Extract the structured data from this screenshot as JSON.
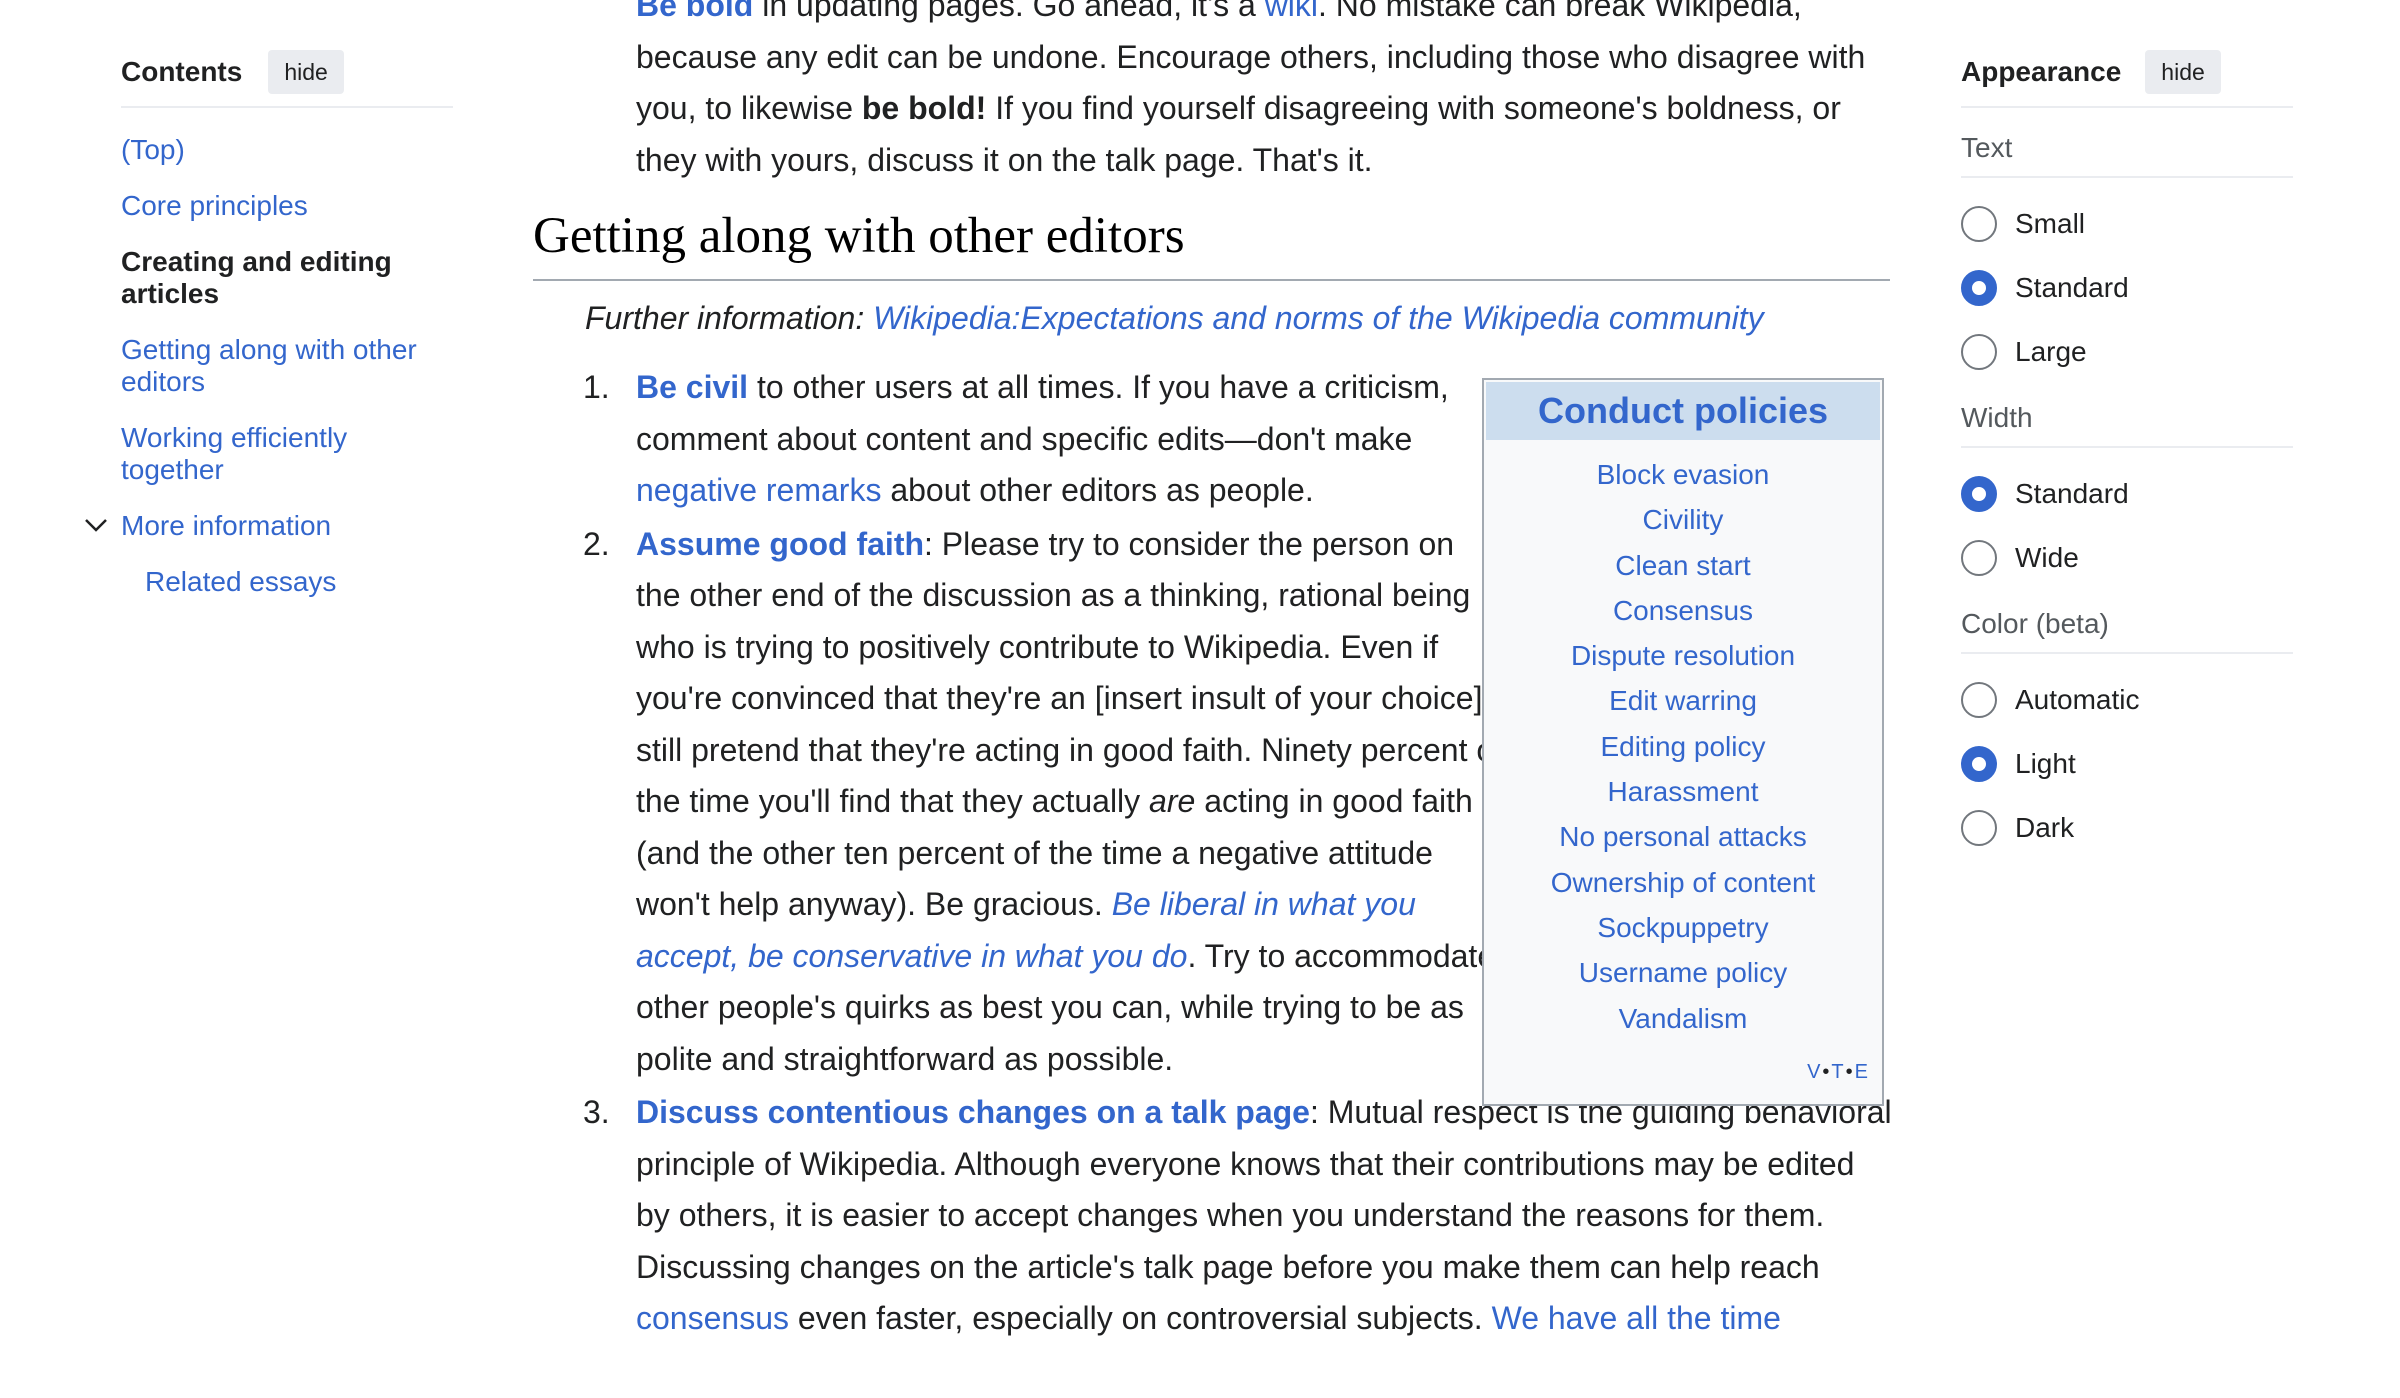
{
  "toc": {
    "title": "Contents",
    "hide_label": "hide",
    "items": [
      {
        "label": "(Top)"
      },
      {
        "label": "Core principles"
      },
      {
        "label": "Creating and editing articles"
      },
      {
        "label": "Getting along with other editors"
      },
      {
        "label": "Working efficiently together"
      },
      {
        "label": "More information"
      },
      {
        "label": "Related essays"
      }
    ]
  },
  "top_para": {
    "line0_a": "Be bold",
    "line0_b": " in updating pages. Go ahead, it's a ",
    "line0_wiki": "wiki",
    "line0_c": ". No mistake can break Wikipedia, because any edit can be undone. Encourage others, including those who disagree with you, to likewise ",
    "be_bold": "be bold!",
    "rest": " If you find yourself disagreeing with someone's boldness, or they with yours, discuss it on the talk page. That's it."
  },
  "section": {
    "heading": "Getting along with other editors",
    "hatnote_prefix": "Further information: ",
    "hatnote_link": "Wikipedia:Expectations and norms of the Wikipedia community"
  },
  "items": {
    "one": {
      "num": "1.",
      "link": "Be civil",
      "text_a": " to other users at all times. If you have a criticism, comment about content and specific edits—don't make ",
      "link2": "negative remarks",
      "text_b": " about other editors as people."
    },
    "two": {
      "num": "2.",
      "link": "Assume good faith",
      "text_a": ": Please try to consider the person on the other end of the discussion as a thinking, rational being who is trying to positively contribute to Wikipedia. Even if you're convinced that they're an [insert insult of your choice], still pretend that they're acting in good faith. Ninety percent of the time you'll find that they actually ",
      "are": "are",
      "text_b": " acting in good faith (and the other ten percent of the time a negative attitude won't help anyway). Be gracious. ",
      "link2": "Be liberal in what you accept, be conservative in what you do",
      "text_c": ". Try to accommodate other people's quirks as best you can, while trying to be as polite and straightforward as possible."
    },
    "three": {
      "num": "3.",
      "link": "Discuss contentious changes on a talk page",
      "text_a": ": Mutual respect is the guiding behavioral principle of Wikipedia. Although everyone knows that their contributions may be edited by others, it is easier to accept changes when you understand the reasons for them. Discussing changes on the article's talk page before you make them can help reach ",
      "link2": "consensus",
      "text_b": " even faster, especially on controversial subjects. ",
      "link3": "We have all the time"
    }
  },
  "navbox": {
    "title": "Conduct policies",
    "items": [
      "Block evasion",
      "Civility",
      "Clean start",
      "Consensus",
      "Dispute resolution",
      "Edit warring",
      "Editing policy",
      "Harassment",
      "No personal attacks",
      "Ownership of content",
      "Sockpuppetry",
      "Username policy",
      "Vandalism"
    ],
    "v": "V",
    "t": "T",
    "e": "E",
    "sep": "•"
  },
  "appearance": {
    "title": "Appearance",
    "hide_label": "hide",
    "text_label": "Text",
    "text_options": [
      "Small",
      "Standard",
      "Large"
    ],
    "text_selected": "Standard",
    "width_label": "Width",
    "width_options": [
      "Standard",
      "Wide"
    ],
    "width_selected": "Standard",
    "color_label": "Color (beta)",
    "color_options": [
      "Automatic",
      "Light",
      "Dark"
    ],
    "color_selected": "Light"
  },
  "colors": {
    "link": "#3366cc",
    "text": "#202122",
    "navbox_title_bg": "#ccddee"
  }
}
